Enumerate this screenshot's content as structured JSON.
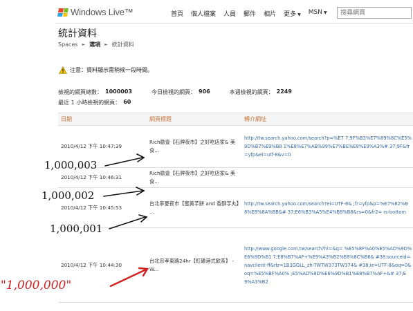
{
  "header": {
    "logo_text": "Windows Live™",
    "nav": [
      {
        "label": "首頁",
        "dropdown": false
      },
      {
        "label": "個人檔案",
        "dropdown": false
      },
      {
        "label": "人員",
        "dropdown": false
      },
      {
        "label": "郵件",
        "dropdown": false
      },
      {
        "label": "相片",
        "dropdown": false
      },
      {
        "label": "更多",
        "dropdown": true
      },
      {
        "label": "MSN",
        "dropdown": true
      }
    ],
    "search_placeholder": "搜尋網頁"
  },
  "page_title": "統計資料",
  "breadcrumb": [
    "Spaces",
    "選項",
    "統計資料"
  ],
  "notice": "注意：資料顯示需稍候一段時間。",
  "stats": {
    "total_label": "檢視的網頁總數：",
    "total_value": "1000003",
    "today_label": "今日檢視的網頁：",
    "today_value": "906",
    "week_label": "本週檢視的網頁：",
    "week_value": "2249",
    "hour_label": "最近 1 小時檢視的網頁：",
    "hour_value": "60"
  },
  "table": {
    "headers": [
      "日期",
      "網頁標題",
      "轉介網址"
    ],
    "rows": [
      {
        "date": "2010/4/12 下午 10:47:39",
        "title": "Rich勸壹【石牌夜市】之好吃店家& 美食...",
        "url": "http://tw.search.yahoo.com/search?p=%E7 7;9F%B3%E7%89%8C%E5%9D%B7%E9%B8 1%E8%E7%AB%99%E7%BE%E8%E9%A3%# 37;9F&fr=yfp&ei=utf-8&v=0"
      },
      {
        "date": "2010/4/12 下午 10:46:31",
        "title": "Rich勸壹【石牌夜市】之好吃店家& 美食...",
        "url": ""
      },
      {
        "date": "2010/4/12 下午 10:45:53",
        "title": "台北寧夏夜市【蜜黃芋餅 and 香酥芋丸】 ...",
        "url": "http://tw.search.yahoo.com/search?ei=UTF-8& ;fr=yfp&p=%E7%82%B8%E8%8A%BB&# 37;E6%B3%A5%E4%B8%B8&rs=0&fr2= rs-bottom"
      },
      {
        "date": "2010/4/12 下午 10:44:30",
        "title": "台北忠孝東路24hr【紅磡港式飲茶】 - W...",
        "url": "http://www.google.com.tw/search?hl=&q= %E5%8F%A0%E5%AD%9D%E6%9D%B1 7;E8%B7%AF+%E9%A3%B2%E8%8C%B6& #38;sourceid=navclient-ff&rlz=1B3GGLL_zh-TWTW373TW374& #38;ie=UTF-8&oq=0&oq=%E5%BF%A0% ;E5%AD%9D%E6%9D%B1%E8%B7%AF+&# 37;E9%A3%B2"
      }
    ]
  },
  "annotations": {
    "a1": "1,000,003",
    "a2": "1,000,002",
    "a3": "1,000,001",
    "a4": "\"1,000,000\""
  },
  "colors": {
    "header_link": "#c8733a",
    "url_blue": "#3366aa",
    "annotation_red": "#d42020",
    "warning_yellow": "#f2c200"
  },
  "icons": {
    "notice": "warning-icon",
    "search": "search-icon"
  }
}
